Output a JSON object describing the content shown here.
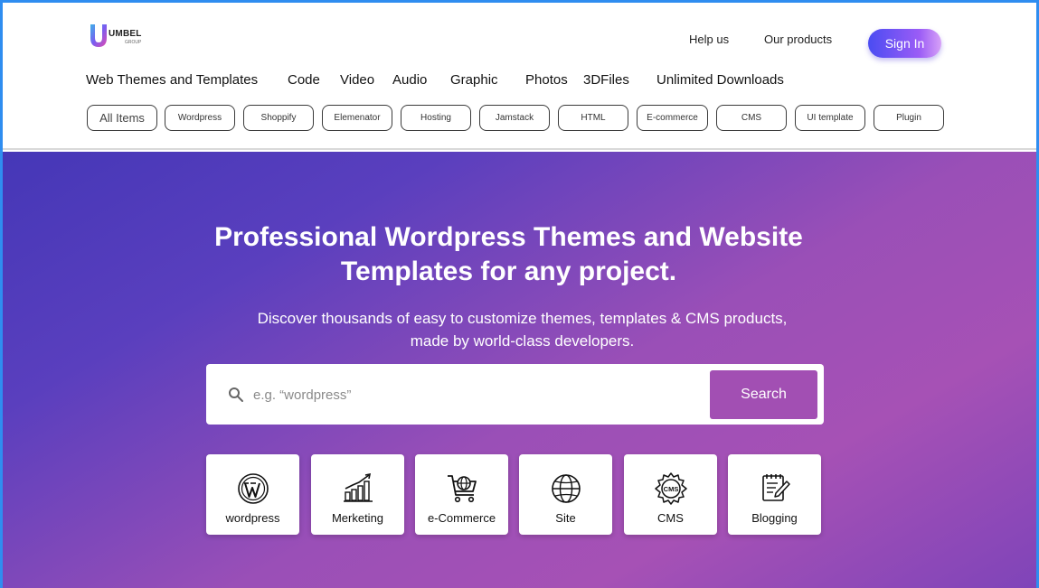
{
  "brand": {
    "logo_word": "UMBEL",
    "logo_sub": "GROUP",
    "colors": {
      "accent": "#a24fb3",
      "signin_start": "#4a4cf2",
      "signin_end": "#d7a1f7"
    }
  },
  "header": {
    "links": {
      "help": "Help us",
      "products": "Our products"
    },
    "signin_label": "Sign In"
  },
  "category_nav": [
    "Web Themes and Templates",
    "Code",
    "Video",
    "Audio",
    "Graphic",
    "Photos",
    "3DFiles",
    "Unlimited Downloads"
  ],
  "chips": [
    "All Items",
    "Wordpress",
    "Shoppify",
    "Elemenator",
    "Hosting",
    "Jamstack",
    "HTML",
    "E-commerce",
    "CMS",
    "UI template",
    "Plugin"
  ],
  "hero": {
    "title_line1": "Professional Wordpress Themes and Website",
    "title_line2": "Templates for any project.",
    "subtitle_line1": "Discover thousands of easy to customize themes, templates & CMS products,",
    "subtitle_line2": "made by world-class developers.",
    "search": {
      "placeholder": "e.g. “wordpress”",
      "button_label": "Search"
    }
  },
  "tiles": [
    {
      "label": "wordpress",
      "icon": "wordpress-icon"
    },
    {
      "label": "Merketing",
      "icon": "marketing-chart-icon"
    },
    {
      "label": "e-Commerce",
      "icon": "shopping-cart-icon"
    },
    {
      "label": "Site",
      "icon": "globe-icon"
    },
    {
      "label": "CMS",
      "icon": "cms-gear-icon"
    },
    {
      "label": "Blogging",
      "icon": "blog-notepad-icon"
    }
  ]
}
